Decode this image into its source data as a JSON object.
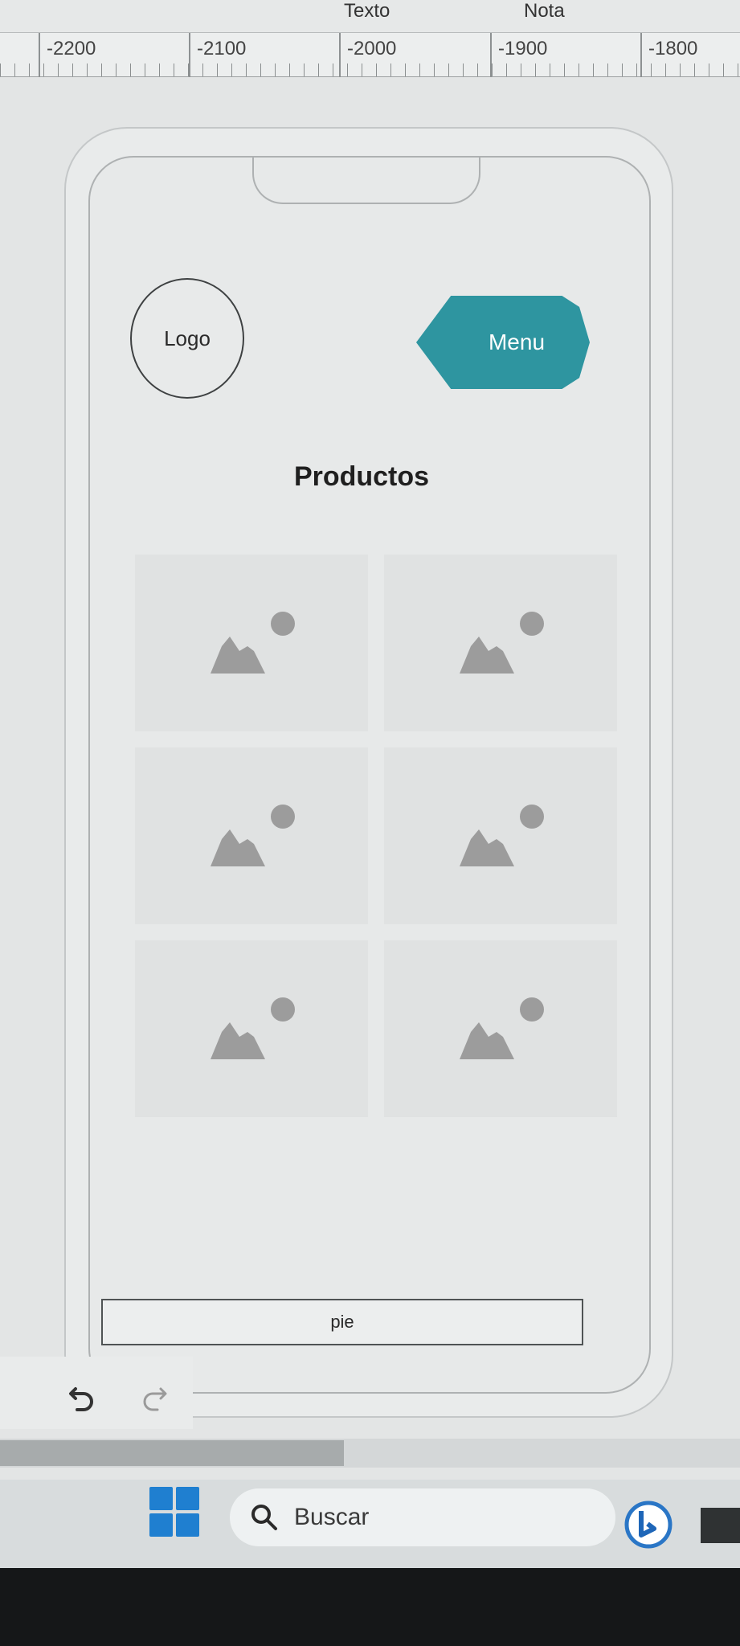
{
  "toolbar": {
    "labels": [
      "Texto",
      "Nota"
    ]
  },
  "ruler": {
    "numbers": [
      "-2200",
      "-2100",
      "-2000",
      "-1900",
      "-1800"
    ]
  },
  "mockup": {
    "logo_label": "Logo",
    "menu_label": "Menu",
    "menu_color": "#2e95a0",
    "title": "Productos",
    "products": [
      {
        "icon": "image-placeholder-icon"
      },
      {
        "icon": "image-placeholder-icon"
      },
      {
        "icon": "image-placeholder-icon"
      },
      {
        "icon": "image-placeholder-icon"
      },
      {
        "icon": "image-placeholder-icon"
      },
      {
        "icon": "image-placeholder-icon"
      }
    ],
    "footer_label": "pie"
  },
  "editor": {
    "undo_icon": "undo-icon",
    "redo_icon": "redo-icon"
  },
  "taskbar": {
    "search_placeholder": "Buscar",
    "start_icon": "windows-start-icon",
    "search_icon": "search-icon",
    "bing_icon": "bing-icon",
    "accent_color": "#1f7fd0"
  }
}
